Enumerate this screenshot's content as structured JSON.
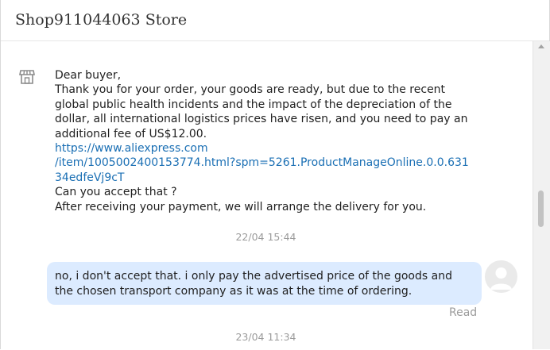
{
  "header": {
    "store_name": "Shop911044063 Store"
  },
  "seller_message": {
    "icon": "store-icon",
    "lines": [
      "Dear buyer,",
      "Thank you for your order, your goods are ready, but due to the recent",
      "global public health incidents and the impact of the depreciation of the",
      "dollar, all international logistics prices have risen, and you need to pay an",
      "additional fee of US$12.00."
    ],
    "link_lines": [
      "https://www.aliexpress.com",
      "/item/1005002400153774.html?spm=5261.ProductManageOnline.0.0.631",
      "34edfeVj9cT"
    ],
    "closing_lines": [
      "Can you accept that ?",
      "After receiving your payment, we will arrange the delivery for you."
    ]
  },
  "timestamps": [
    "22/04 15:44",
    "23/04 11:34"
  ],
  "buyer_message": {
    "lines": [
      "no, i don't accept that. i only pay the advertised price of the goods and",
      "the chosen transport company as it was at the time of ordering."
    ],
    "status": "Read"
  }
}
